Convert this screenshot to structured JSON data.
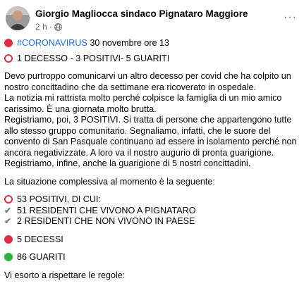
{
  "header": {
    "author": "Giorgio Magliocca sindaco Pignataro Maggiore",
    "time": "2 h",
    "separator": "·",
    "more": "···"
  },
  "post": {
    "hashtag": "#CORONAVIRUS",
    "date_line": " 30 novembre ore 13",
    "summary": "1 DECESSO - 3 POSITIVI- 5 GUARITI",
    "paragraph_1": "Devo purtroppo comunicarvi un altro decesso per covid che ha colpito un nostro concittadino che da settimane era ricoverato in ospedale.",
    "paragraph_2": "La notizia mi rattrista molto perché colpisce la famiglia di un mio amico carissimo. È una giornata molto brutta.",
    "paragraph_3": "Registriamo, poi, 3 POSITIVI. Si tratta di persone che appartengono tutte allo stesso gruppo comunitario. Segnaliamo, infatti, che le suore del convento di San Pasquale continuano ad essere in isolamento perché non ancora negativizzate. A loro va il nostro augurio di pronta guarigione.",
    "paragraph_4": "Registriamo, infine, anche la guarigione di 5 nostri concittadini.",
    "situation": "La situazione complessiva al momento è la seguente:",
    "positives": "53 POSITIVI, DI CUI:",
    "residents_in": "51 RESIDENTI CHE VIVONO A PIGNATARO",
    "residents_out": "2 RESIDENTI CHE NON VIVONO IN PAESE",
    "deaths": "5 DECESSI",
    "recovered": "86 GUARITI",
    "closing": "Vi esorto a rispettare le regole:",
    "check_glyph": "✔"
  }
}
